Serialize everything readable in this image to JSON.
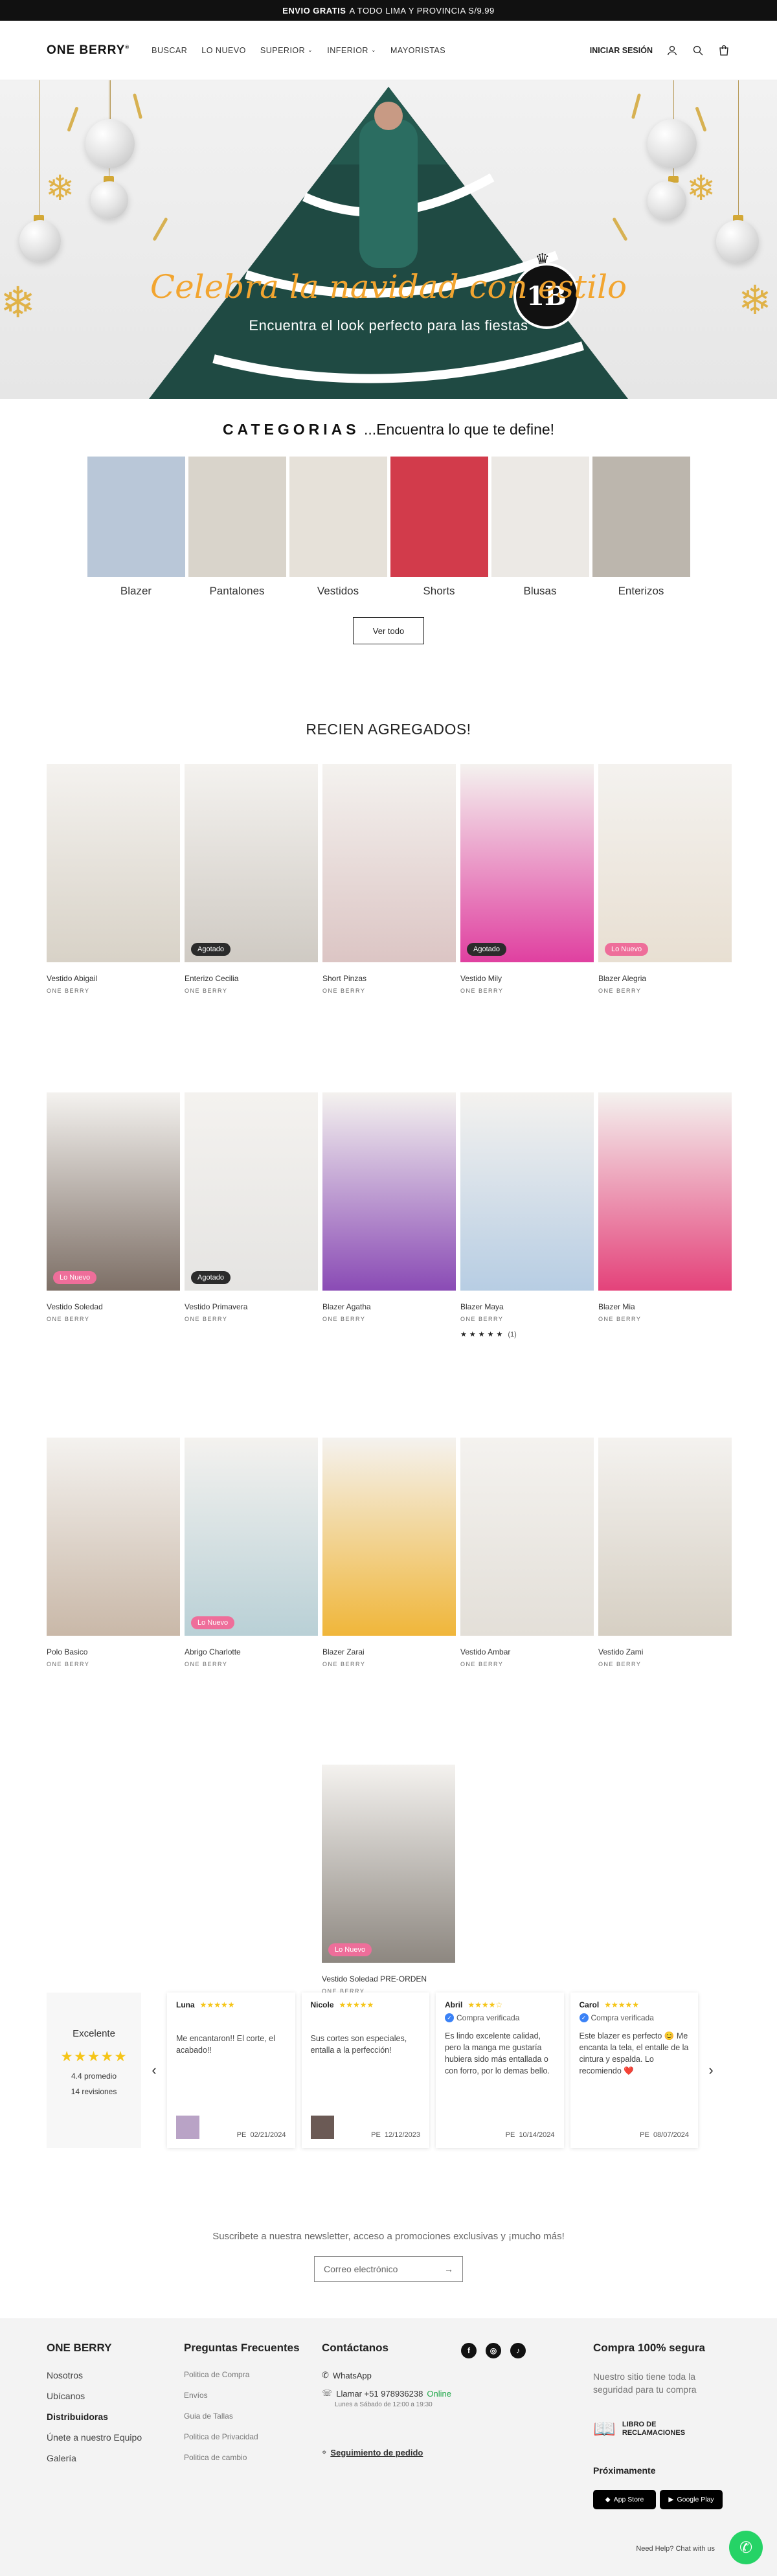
{
  "announcement": {
    "bold": "ENVIO GRATIS",
    "rest": "A TODO LIMA Y PROVINCIA S/9.99"
  },
  "header": {
    "logo": "ONE BERRY",
    "logo_mark": "®",
    "nav": [
      {
        "label": "BUSCAR"
      },
      {
        "label": "LO NUEVO"
      },
      {
        "label": "SUPERIOR",
        "dropdown": true
      },
      {
        "label": "INFERIOR",
        "dropdown": true
      },
      {
        "label": "MAYORISTAS"
      }
    ],
    "login": "INICIAR SESIÓN",
    "icons": [
      "user-icon",
      "search-icon",
      "cart-icon"
    ]
  },
  "hero": {
    "title": "Celebra la navidad con estilo",
    "subtitle": "Encuentra el look perfecto para las fiestas",
    "badge": "1B"
  },
  "categories": {
    "heading_bold": "CATEGORIAS",
    "heading_rest": "...Encuentra lo que te define!",
    "items": [
      {
        "label": "Blazer",
        "color": "#b9c7d8"
      },
      {
        "label": "Pantalones",
        "color": "#d9d4cb"
      },
      {
        "label": "Vestidos",
        "color": "#e6e1d9"
      },
      {
        "label": "Shorts",
        "color": "#d23b4b"
      },
      {
        "label": "Blusas",
        "color": "#ece9e5"
      },
      {
        "label": "Enterizos",
        "color": "#bcb6ad"
      }
    ],
    "button": "Ver todo"
  },
  "recent": {
    "title": "RECIEN AGREGADOS!",
    "rows": [
      [
        {
          "name": "Vestido Abigail",
          "brand": "ONE BERRY",
          "color": "#d8d2c7"
        },
        {
          "name": "Enterizo Cecilia",
          "brand": "ONE BERRY",
          "badge": "Agotado",
          "badge_type": "dark",
          "color": "#cfcac3"
        },
        {
          "name": "Short Pinzas",
          "brand": "ONE BERRY",
          "color": "#dcc5c4"
        },
        {
          "name": "Vestido Mily",
          "brand": "ONE BERRY",
          "badge": "Agotado",
          "badge_type": "dark",
          "color": "#e040a0"
        },
        {
          "name": "Blazer Alegria",
          "brand": "ONE BERRY",
          "badge": "Lo Nuevo",
          "badge_type": "pink",
          "color": "#e8dfd2"
        }
      ],
      [
        {
          "name": "Vestido Soledad",
          "brand": "ONE BERRY",
          "badge": "Lo Nuevo",
          "badge_type": "pink",
          "color": "#7d6f66"
        },
        {
          "name": "Vestido Primavera",
          "brand": "ONE BERRY",
          "badge": "Agotado",
          "badge_type": "dark",
          "color": "#e5e4e2"
        },
        {
          "name": "Blazer Agatha",
          "brand": "ONE BERRY",
          "color": "#8a4bb5"
        },
        {
          "name": "Blazer Maya",
          "brand": "ONE BERRY",
          "rating": "★★★★★",
          "rating_count": "(1)",
          "color": "#b7cde3"
        },
        {
          "name": "Blazer Mia",
          "brand": "ONE BERRY",
          "color": "#e4427a"
        }
      ],
      [
        {
          "name": "Polo Basico",
          "brand": "ONE BERRY",
          "color": "#c9b8a8"
        },
        {
          "name": "Abrigo Charlotte",
          "brand": "ONE BERRY",
          "badge": "Lo Nuevo",
          "badge_type": "pink",
          "color": "#b9d0d6"
        },
        {
          "name": "Blazer Zarai",
          "brand": "ONE BERRY",
          "color": "#f0b63a"
        },
        {
          "name": "Vestido Ambar",
          "brand": "ONE BERRY",
          "color": "#e3dfd8"
        },
        {
          "name": "Vestido Zami",
          "brand": "ONE BERRY",
          "color": "#d6cfc3"
        }
      ],
      [
        {
          "name": "Vestido Soledad PRE-ORDEN",
          "brand": "ONE BERRY",
          "badge": "Lo Nuevo",
          "badge_type": "pink",
          "color": "#8d8780"
        }
      ]
    ]
  },
  "reviews": {
    "summary": {
      "title": "Excelente",
      "stars": "★★★★★",
      "average": "4.4 promedio",
      "count": "14 revisiones"
    },
    "items": [
      {
        "name": "Luna",
        "stars": "★★★★★",
        "verified": "",
        "text": "Me encantaron!! El corte, el acabado!!",
        "country": "PE",
        "date": "02/21/2024",
        "thumb_color": "#b9a3c6"
      },
      {
        "name": "Nicole",
        "stars": "★★★★★",
        "verified": "",
        "text": "Sus cortes son especiales, entalla a la perfección!",
        "country": "PE",
        "date": "12/12/2023",
        "thumb_color": "#6b5a55"
      },
      {
        "name": "Abril",
        "stars": "★★★★☆",
        "verified": "Compra verificada",
        "text": "Es lindo excelente calidad, pero la manga me gustaría hubiera sido más entallada o con forro, por lo demas bello.",
        "country": "PE",
        "date": "10/14/2024"
      },
      {
        "name": "Carol",
        "stars": "★★★★★",
        "verified": "Compra verificada",
        "text": "Este blazer es perfecto 😊 Me encanta la tela, el entalle de la cintura y espalda. Lo recomiendo ❤️",
        "country": "PE",
        "date": "08/07/2024"
      }
    ]
  },
  "newsletter": {
    "text": "Suscribete a nuestra newsletter, acceso a promociones exclusivas y ¡mucho más!",
    "placeholder": "Correo electrónico"
  },
  "footer": {
    "brand": {
      "title": "ONE BERRY",
      "links": [
        "Nosotros",
        "Ubícanos",
        "Distribuidoras",
        "Únete a nuestro Equipo",
        "Galería"
      ]
    },
    "faq": {
      "title": "Preguntas Frecuentes",
      "links": [
        "Politica de Compra",
        "Envíos",
        "Guia de Tallas",
        "Politica de Privacidad",
        "Politica de cambio"
      ]
    },
    "contact": {
      "title": "Contáctanos",
      "whatsapp": "WhatsApp",
      "phone": "Llamar +51 978936238",
      "online": "Online",
      "hours": "Lunes a Sábado de 12:00 a 19:30",
      "tracking": "Seguimiento de pedido",
      "social": [
        "f",
        "◎",
        "♪"
      ]
    },
    "secure": {
      "title": "Compra 100% segura",
      "text": "Nuestro sitio tiene toda la seguridad para tu compra",
      "book": "LIBRO DE RECLAMACIONES",
      "soon": "Próximamente",
      "appstore": "App Store",
      "googleplay": "Google Play"
    },
    "chat_label": "Need Help? Chat with us"
  }
}
